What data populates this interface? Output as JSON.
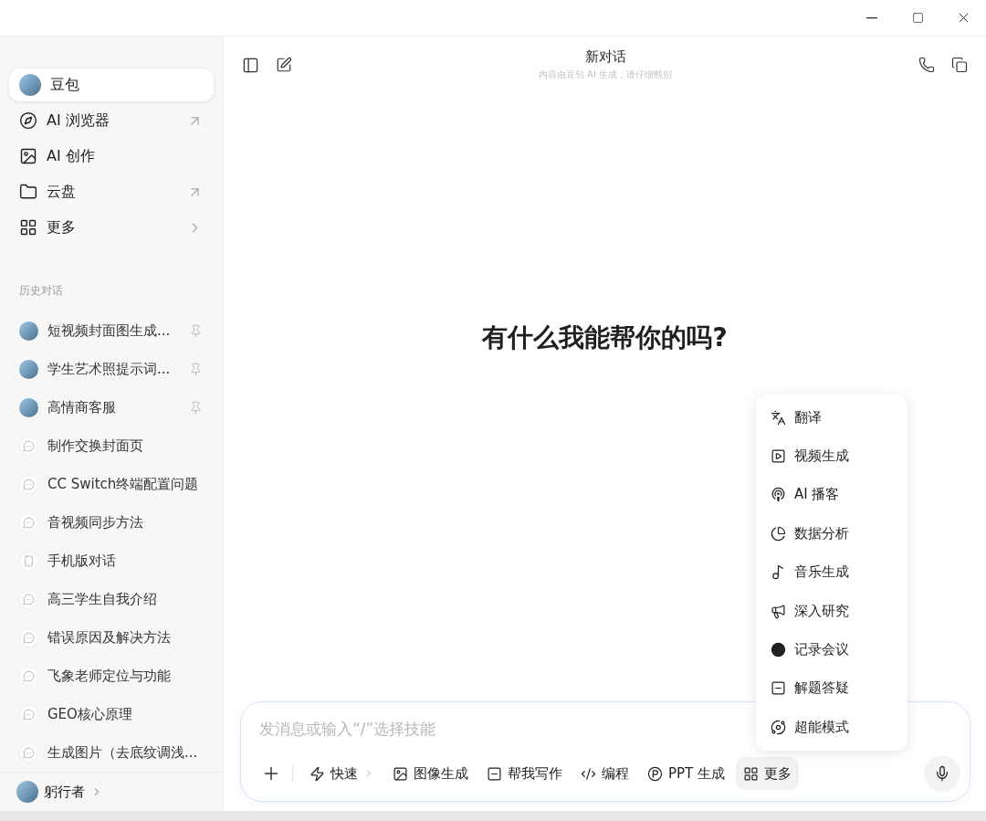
{
  "sidebar": {
    "nav": [
      {
        "label": "豆包",
        "selected": true
      },
      {
        "label": "AI 浏览器",
        "selected": false
      },
      {
        "label": "AI 创作",
        "selected": false
      },
      {
        "label": "云盘",
        "selected": false
      },
      {
        "label": "更多",
        "selected": false
      }
    ],
    "history_title": "历史对话",
    "history": [
      {
        "title": "短视频封面图生成...",
        "kind": "assistant",
        "pinned": true
      },
      {
        "title": "学生艺术照提示词...",
        "kind": "assistant",
        "pinned": true
      },
      {
        "title": "高情商客服",
        "kind": "assistant",
        "pinned": true
      },
      {
        "title": "制作交换封面页",
        "kind": "chat",
        "pinned": false
      },
      {
        "title": "CC Switch终端配置问题",
        "kind": "chat",
        "pinned": false
      },
      {
        "title": "音视频同步方法",
        "kind": "chat",
        "pinned": false
      },
      {
        "title": "手机版对话",
        "kind": "mobile",
        "pinned": false
      },
      {
        "title": "高三学生自我介绍",
        "kind": "chat",
        "pinned": false
      },
      {
        "title": "错误原因及解决方法",
        "kind": "chat",
        "pinned": false
      },
      {
        "title": "飞象老师定位与功能",
        "kind": "chat",
        "pinned": false
      },
      {
        "title": "GEO核心原理",
        "kind": "chat",
        "pinned": false
      },
      {
        "title": "生成图片（去底纹调浅...",
        "kind": "chat",
        "pinned": false
      }
    ],
    "user": {
      "name": "躬行者"
    }
  },
  "header": {
    "title": "新对话",
    "subtitle": "内容由豆包 AI 生成，请仔细甄别"
  },
  "greeting": "有什么我能帮你的吗?",
  "composer": {
    "placeholder": "发消息或输入“/”选择技能",
    "tools": [
      {
        "label": "快速",
        "selected": false
      },
      {
        "label": "图像生成",
        "selected": false
      },
      {
        "label": "帮我写作",
        "selected": false
      },
      {
        "label": "编程",
        "selected": false
      },
      {
        "label": "PPT 生成",
        "selected": false
      },
      {
        "label": "更多",
        "selected": true
      }
    ]
  },
  "more_menu": [
    {
      "label": "翻译"
    },
    {
      "label": "视频生成"
    },
    {
      "label": "AI 播客"
    },
    {
      "label": "数据分析"
    },
    {
      "label": "音乐生成"
    },
    {
      "label": "深入研究"
    },
    {
      "label": "记录会议"
    },
    {
      "label": "解题答疑"
    },
    {
      "label": "超能模式"
    }
  ]
}
